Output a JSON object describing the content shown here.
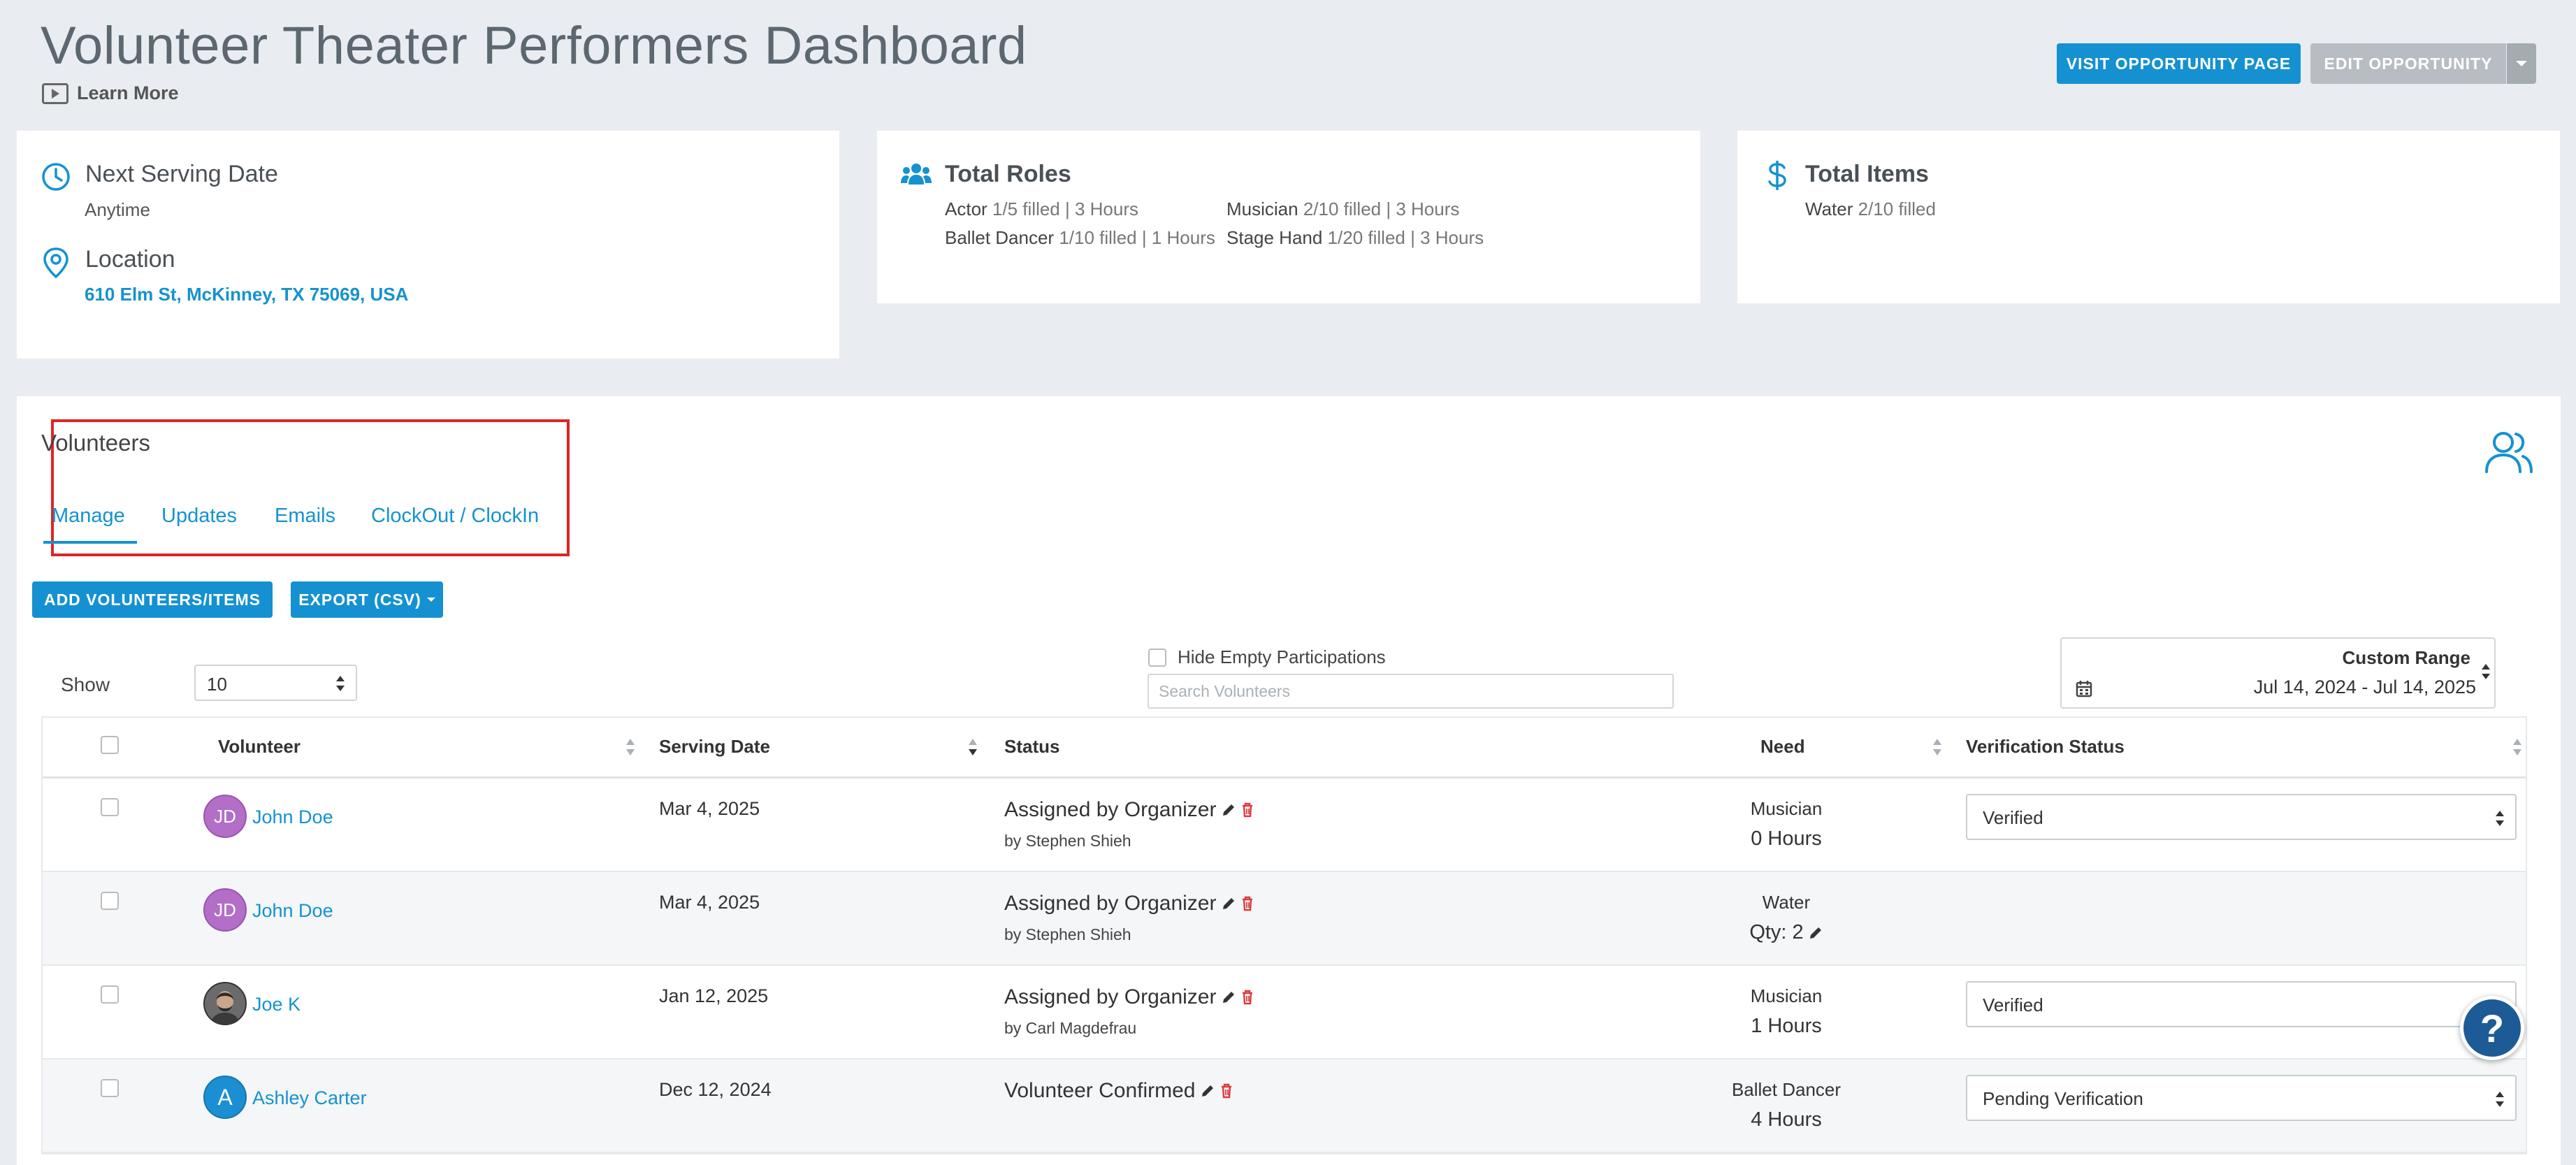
{
  "header": {
    "title": "Volunteer Theater Performers Dashboard",
    "learn_more": "Learn More",
    "visit_button": "VISIT OPPORTUNITY PAGE",
    "edit_button": "EDIT OPPORTUNITY"
  },
  "card_serving": {
    "heading": "Next Serving Date",
    "value": "Anytime",
    "location_heading": "Location",
    "location_value": "610 Elm St, McKinney, TX 75069, USA"
  },
  "card_roles": {
    "heading": "Total Roles",
    "roles": [
      {
        "name": "Actor",
        "meta": "1/5 filled | 3 Hours"
      },
      {
        "name": "Ballet Dancer",
        "meta": "1/10 filled | 1 Hours"
      },
      {
        "name": "Musician",
        "meta": "2/10 filled | 3 Hours"
      },
      {
        "name": "Stage Hand",
        "meta": "1/20 filled | 3 Hours"
      }
    ]
  },
  "card_items": {
    "heading": "Total Items",
    "items": [
      {
        "name": "Water",
        "meta": "2/10 filled"
      }
    ]
  },
  "volunteers": {
    "title": "Volunteers",
    "tabs": [
      "Manage",
      "Updates",
      "Emails",
      "ClockOut / ClockIn"
    ],
    "add_button": "ADD VOLUNTEERS/ITEMS",
    "export_button": "EXPORT (CSV)",
    "show_label": "Show",
    "show_value": "10",
    "hide_empty_label": "Hide Empty Participations",
    "search_placeholder": "Search Volunteers",
    "range_label": "Custom Range",
    "range_dates": "Jul 14, 2024 - Jul 14, 2025"
  },
  "table": {
    "columns": [
      "Volunteer",
      "Serving Date",
      "Status",
      "Need",
      "Verification Status"
    ],
    "rows": [
      {
        "initials": "JD",
        "name": "John Doe",
        "date": "Mar 4, 2025",
        "status": "Assigned by Organizer",
        "by": "by Stephen Shieh",
        "need_role": "Musician",
        "need_value": "0 Hours",
        "verification": "Verified"
      },
      {
        "initials": "JD",
        "name": "John Doe",
        "date": "Mar 4, 2025",
        "status": "Assigned by Organizer",
        "by": "by Stephen Shieh",
        "need_role": "Water",
        "need_value": "Qty: 2",
        "verification": ""
      },
      {
        "initials": "",
        "name": "Joe K",
        "date": "Jan 12, 2025",
        "status": "Assigned by Organizer",
        "by": "by Carl Magdefrau",
        "need_role": "Musician",
        "need_value": "1 Hours",
        "verification": "Verified"
      },
      {
        "initials": "A",
        "name": "Ashley Carter",
        "date": "Dec 12, 2024",
        "status": "Volunteer Confirmed",
        "by": "",
        "need_role": "Ballet Dancer",
        "need_value": "4 Hours",
        "verification": "Pending Verification"
      }
    ]
  },
  "help": {
    "label": "?"
  },
  "colors": {
    "accent": "#1592d0",
    "highlight": "#e02424",
    "delete": "#e0383e"
  }
}
